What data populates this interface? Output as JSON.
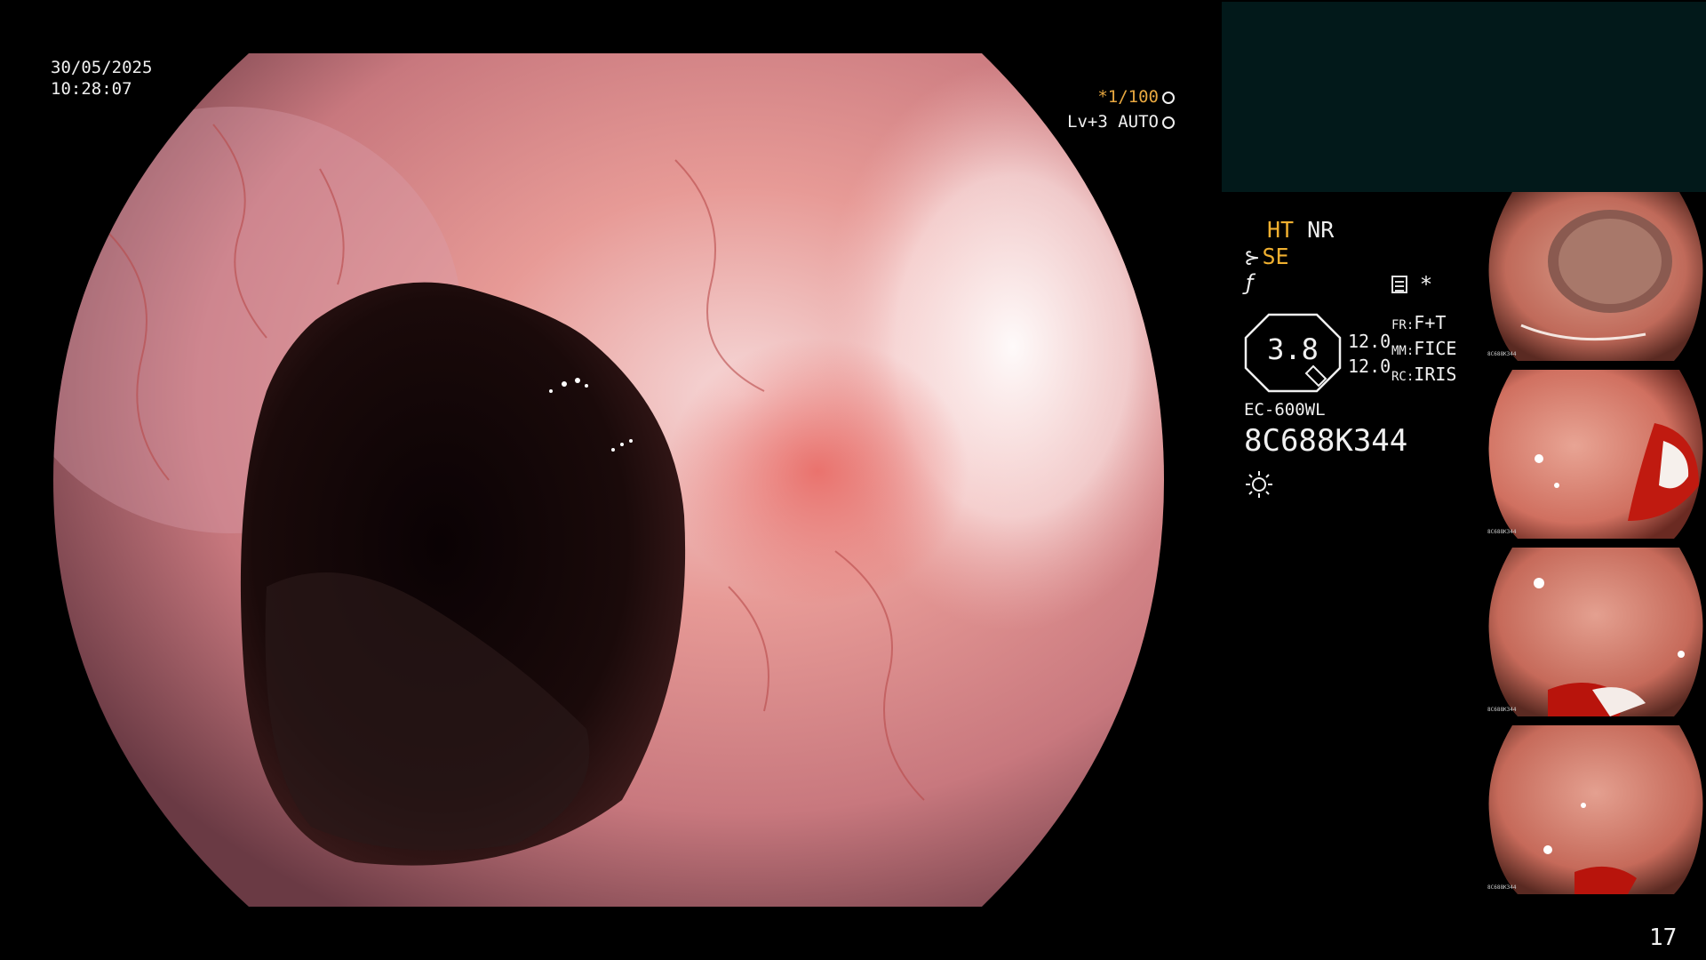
{
  "overlay": {
    "date": "30/05/2025",
    "time": "10:28:07",
    "shutter": "*1/100",
    "level": "Lv+3 AUTO"
  },
  "status": {
    "ht_label": "HT",
    "nr_label": "NR",
    "se_label": "SE",
    "zoom": "3.8",
    "values": [
      "12.0",
      "12.0"
    ],
    "settings": [
      {
        "key": "FR:",
        "value": "F+T"
      },
      {
        "key": "MM:",
        "value": "FICE"
      },
      {
        "key": "RC:",
        "value": "IRIS"
      }
    ],
    "model": "EC-600WL",
    "serial": "8C688K344",
    "colors": {
      "accent": "#f0b030",
      "panel": "#02191a"
    }
  },
  "thumbnails": [
    {
      "name": "thumb-1",
      "index": "",
      "serial": "8C688K344"
    },
    {
      "name": "thumb-2",
      "index": "",
      "serial": "8C688K344"
    },
    {
      "name": "thumb-3",
      "index": "",
      "serial": "8C688K344"
    },
    {
      "name": "thumb-4",
      "index": "",
      "serial": "8C688K344"
    }
  ],
  "page_number": "17"
}
